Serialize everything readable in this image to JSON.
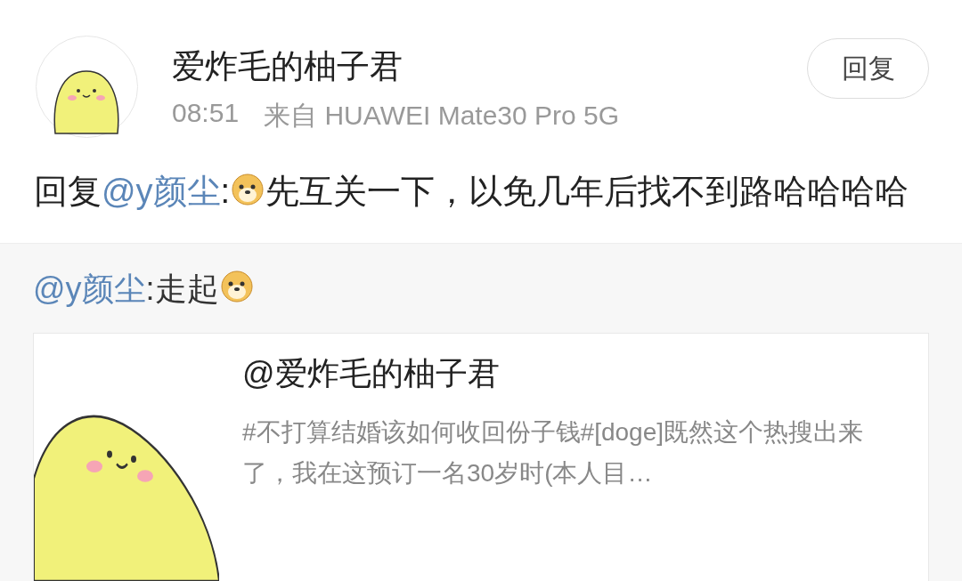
{
  "post": {
    "author": "爱炸毛的柚子君",
    "time": "08:51",
    "source": "来自 HUAWEI Mate30 Pro 5G",
    "reply_button": "回复",
    "content": [
      {
        "kind": "text",
        "text": "回复"
      },
      {
        "kind": "mention",
        "text": "@y颜尘"
      },
      {
        "kind": "text",
        "text": ":"
      },
      {
        "kind": "emoji"
      },
      {
        "kind": "text",
        "text": "先互关一下，以免几年后找不到路哈哈哈哈"
      }
    ]
  },
  "quoted": {
    "content": [
      {
        "kind": "mention",
        "text": "@y颜尘"
      },
      {
        "kind": "text",
        "text": ":走起"
      },
      {
        "kind": "emoji"
      }
    ],
    "card": {
      "title": "@爱炸毛的柚子君",
      "description": "#不打算结婚该如何收回份子钱#[doge]既然这个热搜出来了，我在这预订一名30岁时(本人目…"
    }
  }
}
